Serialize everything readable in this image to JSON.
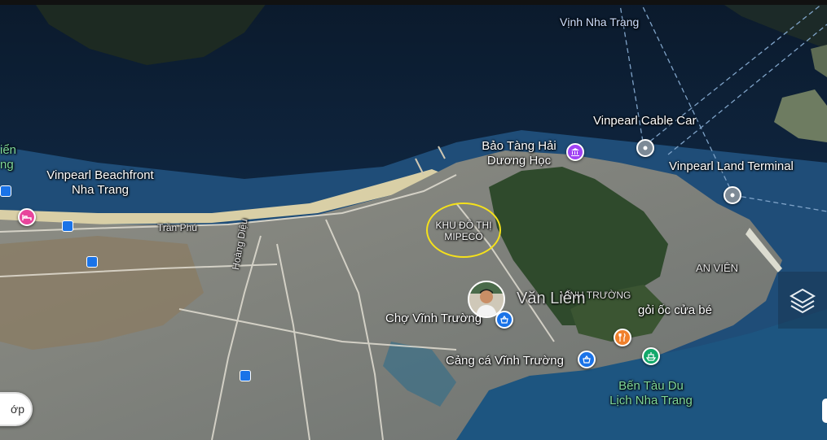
{
  "map": {
    "labels": {
      "vinh_nha_trang": "Vịnh Nha Trang",
      "vinpearl_cable_car": "Vinpearl Cable Car",
      "bao_tang_line1": "Bảo Tàng Hải",
      "bao_tang_line2": "Dương Học",
      "vinpearl_land_terminal": "Vinpearl Land Terminal",
      "vinpearl_beachfront_line1": "Vinpearl Beachfront",
      "vinpearl_beachfront_line2": "Nha Trang",
      "left_green_line1": "iển",
      "left_green_line2": "ng",
      "tran_phu": "Trần Phú",
      "hoang_dieu": "Hoàng Diệu",
      "khu_do_thi_line1": "KHU ĐÔ THỊ",
      "khu_do_thi_line2": "MIPECO",
      "an_vien": "AN VIÊN",
      "vinh_truong": "VĨNH TRƯỜNG",
      "van_liem": "Văn Liêm",
      "goi_oc": "gỏi ốc cửa bé",
      "cho_vinh_truong": "Chợ Vĩnh Trường",
      "cang_ca": "Cảng cá Vĩnh Trường",
      "ben_tau_line1": "Bến Tàu Du",
      "ben_tau_line2": "Lịch Nha Trang"
    },
    "left_button_label": "ớp",
    "icons": {
      "museum": "museum-icon",
      "cable_car": "location-pin-icon",
      "terminal": "location-pin-icon",
      "hotel": "hotel-icon",
      "market": "shopping-basket-icon",
      "port": "shopping-basket-icon",
      "restaurant": "restaurant-icon",
      "ferry": "ferry-icon",
      "layers": "layers-icon"
    },
    "colors": {
      "museum_pin": "#a142f4",
      "gray_pin": "#7d8a96",
      "hotel_pin": "#e8459c",
      "market_pin": "#1a73e8",
      "restaurant_pin": "#f0802c",
      "ferry_pin": "#12a86a",
      "highlight_ellipse": "#f5e11b"
    }
  }
}
